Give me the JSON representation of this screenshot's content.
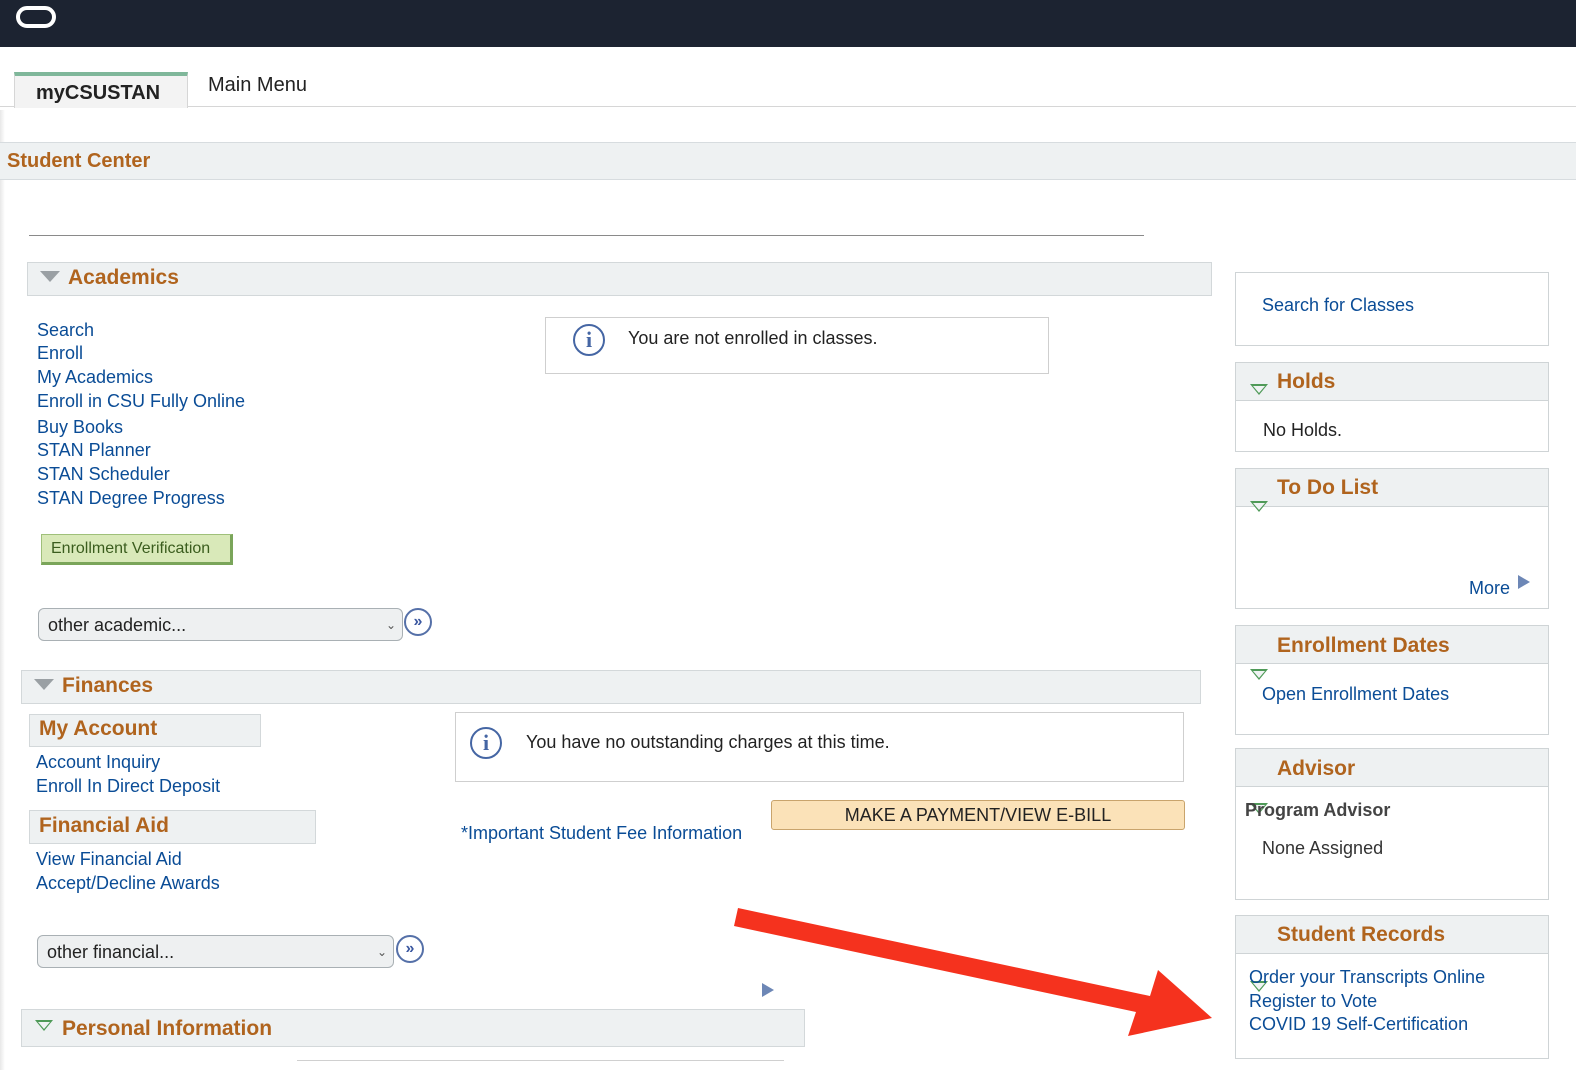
{
  "tabs": {
    "active": "myCSUSTAN",
    "main_menu": "Main Menu"
  },
  "page_title": "Student Center",
  "academics": {
    "title": "Academics",
    "links": [
      "Search",
      "Enroll",
      "My Academics",
      "Enroll in CSU Fully Online",
      "Buy Books",
      "STAN Planner",
      "STAN Scheduler",
      "STAN Degree Progress"
    ],
    "notice": "You are not enrolled in classes.",
    "verification_button": "Enrollment Verification",
    "other_select": "other academic..."
  },
  "finances": {
    "title": "Finances",
    "my_account": {
      "title": "My Account",
      "links": [
        "Account Inquiry",
        "Enroll In Direct Deposit"
      ]
    },
    "financial_aid": {
      "title": "Financial Aid",
      "links": [
        "View Financial Aid",
        "Accept/Decline Awards"
      ]
    },
    "notice": "You have no outstanding charges at this time.",
    "fee_link": "*Important Student Fee Information",
    "pay_button": "MAKE A PAYMENT/VIEW E-BILL",
    "other_select": "other financial..."
  },
  "personal_info": {
    "title": "Personal Information"
  },
  "right": {
    "search_classes": "Search for Classes",
    "holds": {
      "title": "Holds",
      "text": "No Holds."
    },
    "todo": {
      "title": "To Do List",
      "more": "More"
    },
    "enrollment_dates": {
      "title": "Enrollment Dates",
      "link": "Open Enrollment Dates"
    },
    "advisor": {
      "title": "Advisor",
      "label": "Program Advisor",
      "value": "None Assigned"
    },
    "student_records": {
      "title": "Student Records",
      "links": [
        "Order your Transcripts Online",
        "Register to Vote",
        "COVID 19 Self-Certification"
      ]
    }
  },
  "colors": {
    "topbar": "#1c2331",
    "section_title": "#b0641e",
    "link": "#0a4c96",
    "annotation_arrow": "#f5321e"
  },
  "icons": {
    "info": "info-circle-icon",
    "go": "double-chevron-right-icon",
    "collapse": "triangle-down-icon",
    "more": "play-arrow-icon"
  }
}
